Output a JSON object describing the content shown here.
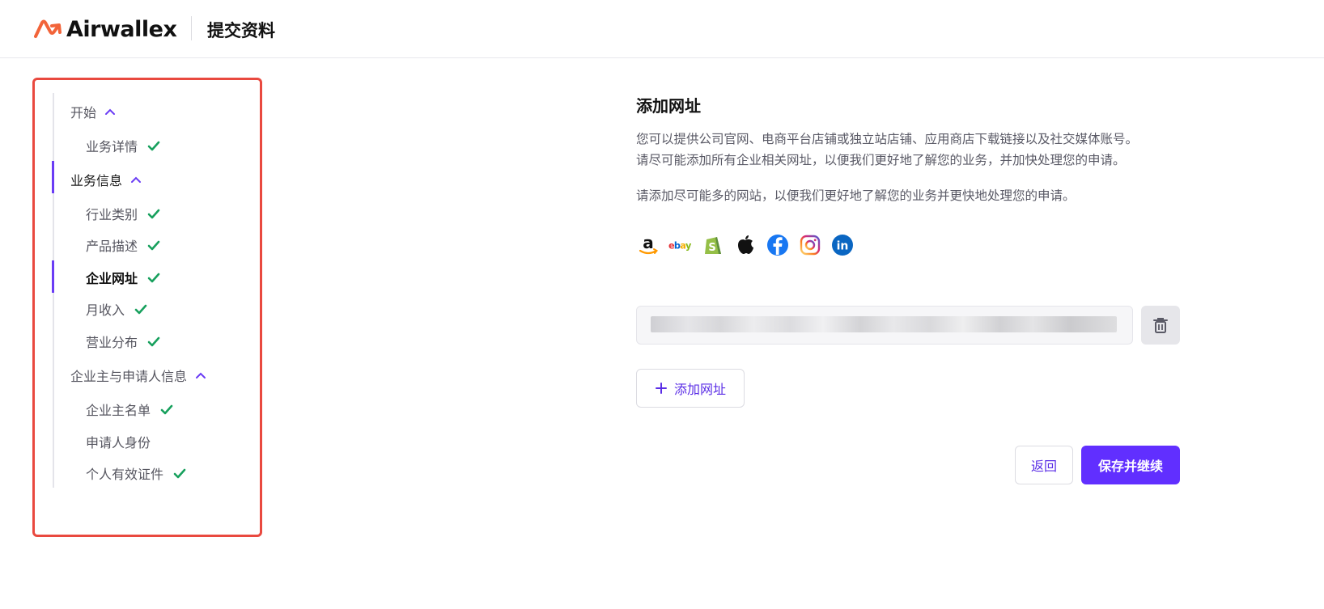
{
  "header": {
    "brand": "Airwallex",
    "title": "提交资料"
  },
  "colors": {
    "accent": "#612fff",
    "check": "#17a05d",
    "highlight_frame": "#e9493f"
  },
  "sidebar": {
    "groups": [
      {
        "label": "开始",
        "items": [
          {
            "label": "业务详情",
            "done": true
          }
        ]
      },
      {
        "label": "业务信息",
        "items": [
          {
            "label": "行业类别",
            "done": true
          },
          {
            "label": "产品描述",
            "done": true
          },
          {
            "label": "企业网址",
            "done": true,
            "current": true
          },
          {
            "label": "月收入",
            "done": true
          },
          {
            "label": "营业分布",
            "done": true
          }
        ]
      },
      {
        "label": "企业主与申请人信息",
        "items": [
          {
            "label": "企业主名单",
            "done": true
          },
          {
            "label": "申请人身份",
            "done": false
          },
          {
            "label": "个人有效证件",
            "done": true
          }
        ]
      }
    ]
  },
  "main": {
    "title": "添加网址",
    "desc_line1": "您可以提供公司官网、电商平台店铺或独立站店铺、应用商店下载链接以及社交媒体账号。",
    "desc_line2": "请尽可能添加所有企业相关网址，以便我们更好地了解您的业务，并加快处理您的申请。",
    "desc_line3": "请添加尽可能多的网站，以便我们更好地了解您的业务并更快地处理您的申请。",
    "social_icons": [
      "amazon-icon",
      "ebay-icon",
      "shopify-icon",
      "apple-icon",
      "facebook-icon",
      "instagram-icon",
      "linkedin-icon"
    ],
    "ebay_text": "ebay",
    "amazon_text": "a",
    "linkedin_text": "in",
    "url_value": "",
    "add_url_label": "添加网址",
    "back_label": "返回",
    "save_label": "保存并继续"
  }
}
